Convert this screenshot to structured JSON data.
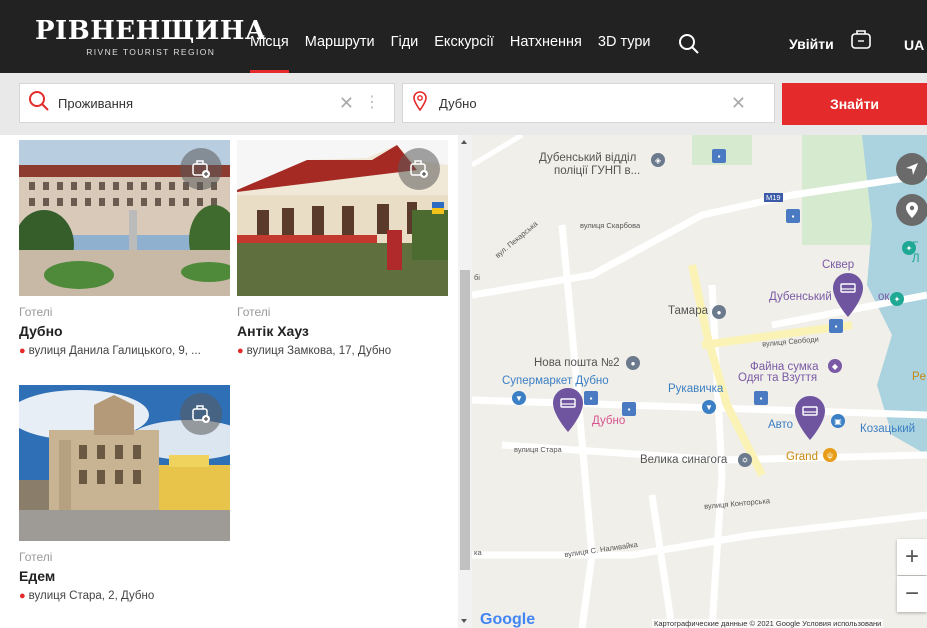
{
  "header": {
    "logo_main": "РІВНЕНЩИНА",
    "logo_sub": "RIVNE TOURIST REGION",
    "nav": [
      "Місця",
      "Маршрути",
      "Гіди",
      "Екскурсії",
      "Натхнення",
      "3D тури"
    ],
    "login": "Увійти",
    "lang": "UA"
  },
  "search": {
    "category_value": "Проживання",
    "location_value": "Дубно",
    "find_label": "Знайти"
  },
  "cards": [
    {
      "category": "Готелі",
      "name": "Дубно",
      "address": "вулиця Данила Галицького, 9, ..."
    },
    {
      "category": "Готелі",
      "name": "Антік Хауз",
      "address": "вулиця Замкова, 17, Дубно"
    },
    {
      "category": "Готелі",
      "name": "Едем",
      "address": "вулиця Стара, 2, Дубно"
    }
  ],
  "map": {
    "labels": {
      "police": "Дубенський відділ",
      "police2": "поліції ГУНП в...",
      "skver": "Сквер",
      "dub_park": "Дубенський",
      "park_suffix": "ок",
      "tamara": "Тамара",
      "nova_poshta": "Нова пошта №2",
      "supermarket": "Супермаркет Дубно",
      "rukavychka": "Рукавичка",
      "fayna1": "Файна сумка",
      "fayna2": "Одяг та Взуття",
      "dubno_pink": "Дубно",
      "avto": "Авто",
      "kozatskyi": "Козацький",
      "synagogue": "Велика синагога",
      "grand": "Grand",
      "per": "Pe",
      "g_right": "Г",
      "l_right": "Л"
    },
    "streets": {
      "skarbova": "вулиця Скарбова",
      "pekarska": "вул. Пекарська",
      "svobody": "вулиця Свободи",
      "stara": "вулиця Стара",
      "kontorska": "вулиця Конторська",
      "nalyvaika": "вулиця С. Наливайка",
      "m19": "M19",
      "ka": "ка",
      "bi": "бі"
    },
    "google": "Google",
    "attribution": "Картографические данные © 2021 Google    Условия использовани",
    "zoom_in": "+",
    "zoom_out": "−"
  }
}
